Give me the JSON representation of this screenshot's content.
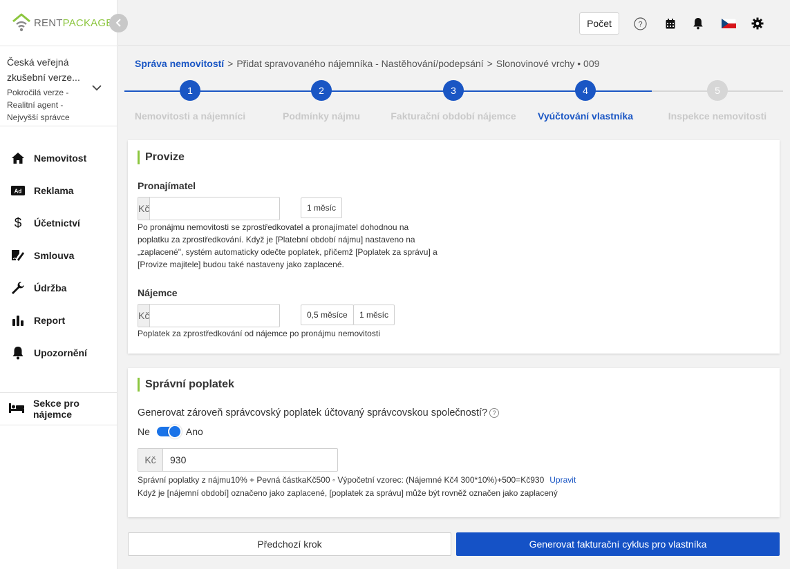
{
  "brand": {
    "logo_a": "RENT",
    "logo_b": "PACKAGE",
    "accent": "#1a56c4",
    "green": "#8cc63f"
  },
  "account": {
    "name": "Česká veřejná zkušební verze...",
    "role": "Pokročilá verze - Realitní agent - Nejvyšší správce"
  },
  "nav": [
    {
      "label": "Nemovitost",
      "icon": "home-icon"
    },
    {
      "label": "Reklama",
      "icon": "ad-icon"
    },
    {
      "label": "Účetnictví",
      "icon": "dollar-icon"
    },
    {
      "label": "Smlouva",
      "icon": "contract-icon"
    },
    {
      "label": "Údržba",
      "icon": "wrench-icon"
    },
    {
      "label": "Report",
      "icon": "bar-chart-icon"
    },
    {
      "label": "Upozornění",
      "icon": "bell-icon"
    }
  ],
  "tenant_section": {
    "label": "Sekce pro nájemce",
    "icon": "bed-icon"
  },
  "header": {
    "count_button": "Počet",
    "icons": [
      "help-icon",
      "calendar-icon",
      "bell-icon",
      "czech-flag-icon",
      "gear-icon"
    ]
  },
  "breadcrumb": {
    "root": "Správa nemovitostí",
    "sep": ">",
    "middle": "Přidat spravovaného nájemníka - Nastěhování/podepsání",
    "last": "Slonovinové vrchy • 009"
  },
  "steps": [
    {
      "num": "1",
      "label": "Nemovitosti a nájemníci",
      "state": "done"
    },
    {
      "num": "2",
      "label": "Podmínky nájmu",
      "state": "done"
    },
    {
      "num": "3",
      "label": "Fakturační období nájemce",
      "state": "done"
    },
    {
      "num": "4",
      "label": "Vyúčtování vlastníka",
      "state": "active"
    },
    {
      "num": "5",
      "label": "Inspekce nemovitosti",
      "state": "todo"
    }
  ],
  "provize": {
    "title": "Provize",
    "landlord_label": "Pronajímatel",
    "currency": "Kč",
    "landlord_value": "",
    "landlord_chip": "1 měsíc",
    "landlord_help": "Po pronájmu nemovitosti se zprostředkovatel a pronajímatel dohodnou na poplatku za zprostředkování. Když je [Platební období nájmu] nastaveno na „zaplacené\", systém automaticky odečte poplatek, přičemž [Poplatek za správu] a [Provize majitele] budou také nastaveny jako zaplacené.",
    "tenant_label": "Nájemce",
    "tenant_value": "",
    "tenant_chip_1": "0,5 měsíce",
    "tenant_chip_2": "1 měsíc",
    "tenant_help": "Poplatek za zprostředkování od nájemce po pronájmu nemovitosti"
  },
  "spravni": {
    "title": "Správní poplatek",
    "question": "Generovat zároveň správcovský poplatek účtovaný správcovskou společností?",
    "no": "Ne",
    "yes": "Ano",
    "toggle_on": true,
    "currency": "Kč",
    "value": "930",
    "formula": "Správní poplatky z nájmu10% + Pevná částkaKč500 ◦ Výpočetní vzorec: (Nájemné Kč4 300*10%)+500=Kč930",
    "edit": "Upravit",
    "note": "Když je [nájemní období] označeno jako zaplacené, [poplatek za správu] může být rovněž označen jako zaplacený"
  },
  "actions": {
    "prev": "Předchozí krok",
    "next": "Generovat fakturační cyklus pro vlastníka"
  }
}
